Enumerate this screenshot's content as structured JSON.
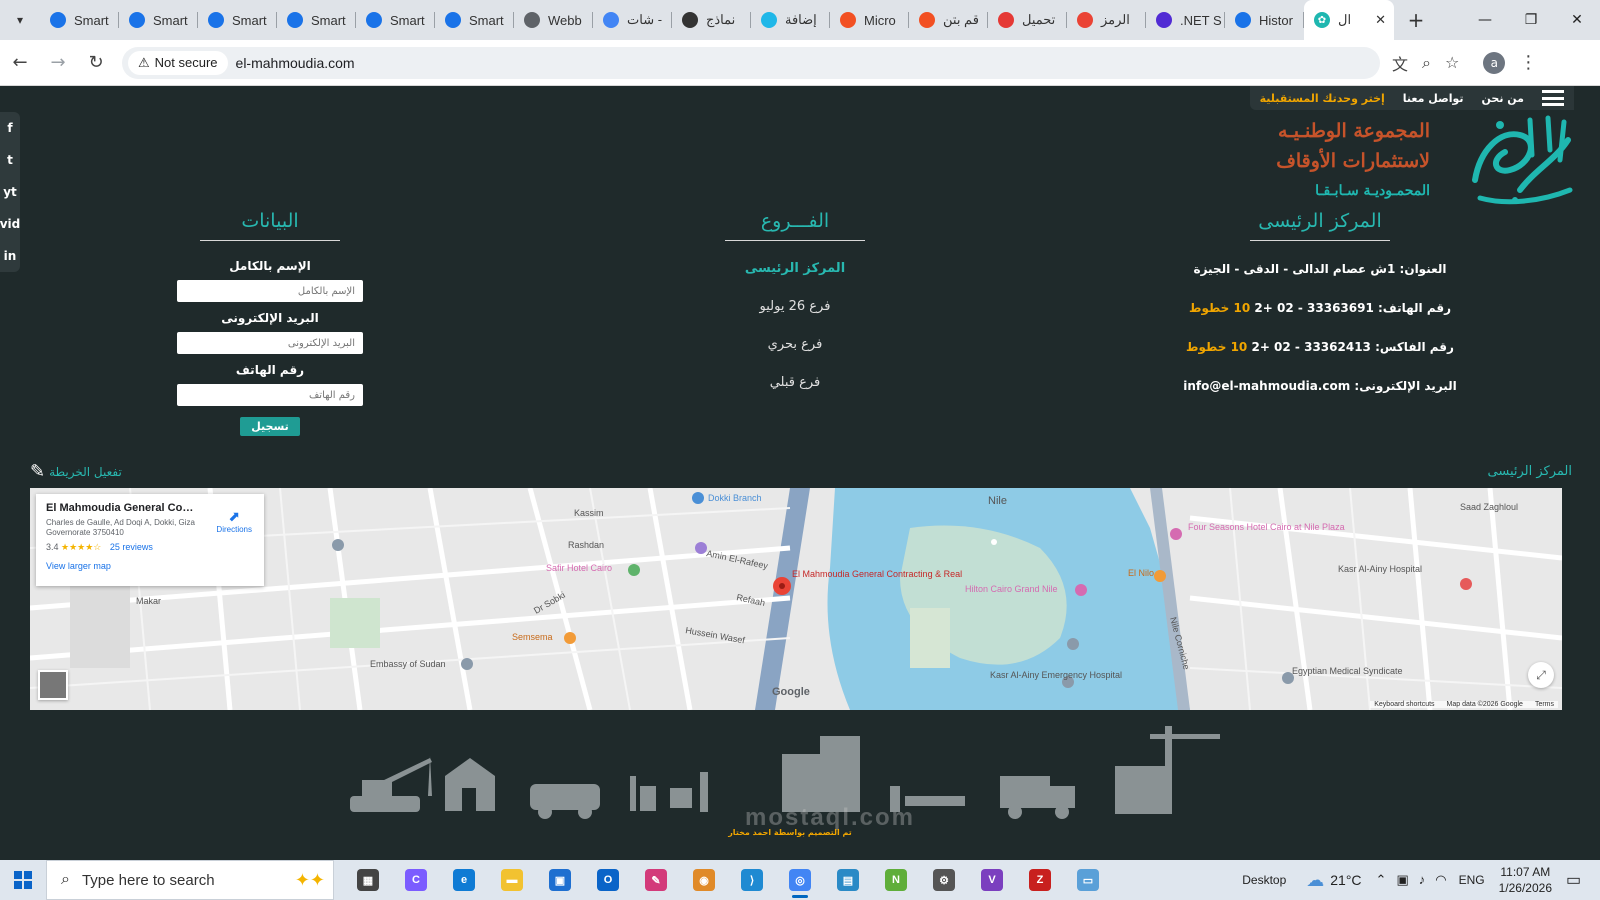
{
  "browser": {
    "tabs": [
      {
        "label": "Smart",
        "icon": "smartcv-icon",
        "color": "#1a73e8"
      },
      {
        "label": "Smart",
        "icon": "smartcv-icon",
        "color": "#1a73e8"
      },
      {
        "label": "Smart",
        "icon": "smartcv-icon",
        "color": "#1a73e8"
      },
      {
        "label": "Smart",
        "icon": "smartcv-icon",
        "color": "#1a73e8"
      },
      {
        "label": "Smart",
        "icon": "smartcv-icon",
        "color": "#1a73e8"
      },
      {
        "label": "Smart",
        "icon": "smartcv-icon",
        "color": "#1a73e8"
      },
      {
        "label": "Webb",
        "icon": "globe-icon",
        "color": "#5f6368"
      },
      {
        "label": "شات -",
        "icon": "google-icon",
        "color": "#4285f4"
      },
      {
        "label": "نماذج",
        "icon": "openai-icon",
        "color": "#333333"
      },
      {
        "label": "إضافة",
        "icon": "extension-icon",
        "color": "#1fb7e8"
      },
      {
        "label": "Micro",
        "icon": "microsoft-icon",
        "color": "#f25022"
      },
      {
        "label": "قم بتن",
        "icon": "microsoft-icon",
        "color": "#f25022"
      },
      {
        "label": "تحميل",
        "icon": "play-icon",
        "color": "#e53935"
      },
      {
        "label": "الرمز",
        "icon": "gmail-icon",
        "color": "#ea4335"
      },
      {
        "label": ".NET S",
        "icon": "dotnet-icon",
        "color": "#512bd4"
      },
      {
        "label": "Histor",
        "icon": "history-icon",
        "color": "#1a73e8"
      }
    ],
    "active_tab": {
      "label": "ال",
      "icon": "site-icon",
      "color": "#1fb7b0"
    },
    "new_tab": "+",
    "not_secure": "Not secure",
    "url": "el-mahmoudia.com",
    "profile_letter": "a"
  },
  "site": {
    "nav": {
      "about": "من نحن",
      "contact": "تواصل معنا",
      "future_unit": "إختر وحدتك المستقبلية"
    },
    "brand": {
      "line1": "المجموعة الوطنـيـه",
      "line2": "لاستثمارات الأوقاف",
      "line3": "المحمـوديـة سـابـقـا"
    },
    "social": [
      "f",
      "t",
      "yt",
      "vid",
      "in"
    ],
    "hq": {
      "title": "المركز الرئيسى",
      "address": "العنوان: 1ش عصام الدالى - الدقى - الجيزة",
      "phone_prefix": "رقم الهاتف: 33363691 - 02 +2",
      "phone_suffix": "10 خطوط",
      "fax_prefix": "رقم الفاكس: 33362413 - 02 +2",
      "fax_suffix": "10 خطوط",
      "email": "البريد الإلكترونى: info@el-mahmoudia.com"
    },
    "branches": {
      "title": "الفـــروع",
      "items": [
        "المركز الرئيسى",
        "فرع 26 يوليو",
        "فرع بحري",
        "فرع قبلي"
      ]
    },
    "form": {
      "title": "البيانات",
      "name_label": "الإسم بالكامل",
      "name_placeholder": "الإسم بالكامل",
      "email_label": "البريد الإلكترونى",
      "email_placeholder": "البريد الإلكترونى",
      "phone_label": "رقم الهاتف",
      "phone_placeholder": "رقم الهاتف",
      "submit": "تسجيل"
    },
    "map_activate": "تفعيل الخريطة",
    "map_hq_label": "المركز الرئيسى",
    "map": {
      "place_name": "El Mahmoudia General Contra...",
      "address": "Charles de Gaulle, Ad Doqi A, Dokki, Giza Governorate 3750410",
      "rating": "3.4",
      "stars": "★★★★☆",
      "reviews": "25 reviews",
      "directions": "Directions",
      "larger_map": "View larger map",
      "google": "Google",
      "keyboard": "Keyboard shortcuts",
      "mapdata": "Map data ©2026 Google",
      "terms": "Terms",
      "labels": [
        "Kassim",
        "Rashdan",
        "Amin El-Rafeey",
        "Refaah",
        "Hussein Wasef",
        "Safir Hotel Cairo",
        "Semsema",
        "Embassy of Sudan",
        "Dokki Branch",
        "El Mahmoudia General Contracting & Real",
        "Nile",
        "Hilton Cairo Grand Nile",
        "Four Seasons Hotel Cairo at Nile Plaza",
        "Saad Zaghloul",
        "Kasr Al-Ainy Hospital",
        "Egyptian Medical Syndicate",
        "Kasr Al-Ainy Emergency Hospital",
        "Nile Corniche",
        "Makar",
        "Dr Sobki",
        "El Nilo"
      ]
    },
    "designer": "تم التصميم بواسطة احمد مختار",
    "watermark": "mostaql.com"
  },
  "taskbar": {
    "search_placeholder": "Type here to search",
    "desktop": "Desktop",
    "temp": "21°C",
    "lang": "ENG",
    "time": "11:07 AM",
    "date": "1/26/2026",
    "apps": [
      {
        "name": "task-view",
        "color": "#444444",
        "glyph": "▦"
      },
      {
        "name": "copilot",
        "color": "#7b5cff",
        "glyph": "C"
      },
      {
        "name": "edge",
        "color": "#0f7bd4",
        "glyph": "e"
      },
      {
        "name": "file-explorer",
        "color": "#f2c230",
        "glyph": "▬"
      },
      {
        "name": "store",
        "color": "#1e6fd0",
        "glyph": "▣"
      },
      {
        "name": "outlook",
        "color": "#0a64c8",
        "glyph": "O"
      },
      {
        "name": "paint",
        "color": "#d33a7a",
        "glyph": "✎"
      },
      {
        "name": "paint-3d",
        "color": "#e08a28",
        "glyph": "◉"
      },
      {
        "name": "vscode",
        "color": "#1f8ad2",
        "glyph": "⟩"
      },
      {
        "name": "chrome",
        "color": "#4285f4",
        "glyph": "◎"
      },
      {
        "name": "photos",
        "color": "#2a8ac6",
        "glyph": "▤"
      },
      {
        "name": "notepad-plus",
        "color": "#5fae3a",
        "glyph": "N"
      },
      {
        "name": "settings",
        "color": "#555555",
        "glyph": "⚙"
      },
      {
        "name": "visual-studio",
        "color": "#7b3fbf",
        "glyph": "V"
      },
      {
        "name": "filezilla",
        "color": "#c8201e",
        "glyph": "Z"
      },
      {
        "name": "notepad",
        "color": "#5aa0d8",
        "glyph": "▭"
      }
    ]
  }
}
